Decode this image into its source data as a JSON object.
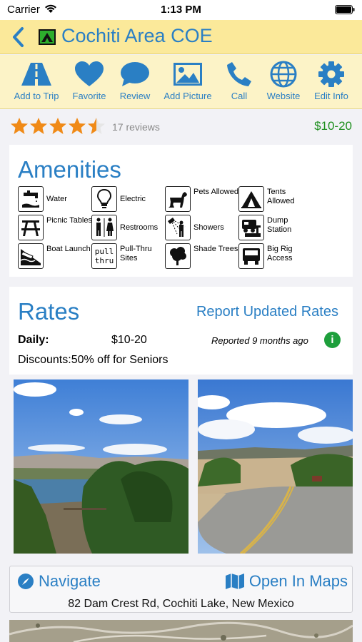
{
  "status_bar": {
    "carrier": "Carrier",
    "time": "1:13 PM"
  },
  "header": {
    "title": "Cochiti Area COE",
    "icon": "tent-icon"
  },
  "toolbar": [
    {
      "label": "Add to Trip",
      "icon": "road-icon"
    },
    {
      "label": "Favorite",
      "icon": "heart-icon"
    },
    {
      "label": "Review",
      "icon": "speech-bubble-icon"
    },
    {
      "label": "Add Picture",
      "icon": "image-icon"
    },
    {
      "label": "Call",
      "icon": "phone-icon"
    },
    {
      "label": "Website",
      "icon": "globe-icon"
    },
    {
      "label": "Edit Info",
      "icon": "gear-icon"
    }
  ],
  "rating": {
    "stars": 4.5,
    "max": 5,
    "reviews": "17 reviews",
    "price": "$10-20"
  },
  "amenities": {
    "title": "Amenities",
    "items": [
      {
        "label": "Water",
        "icon": "water-faucet-icon"
      },
      {
        "label": "Electric",
        "icon": "lightbulb-icon"
      },
      {
        "label": "Pets Allowed",
        "icon": "pets-icon"
      },
      {
        "label": "Tents Allowed",
        "icon": "tent-icon"
      },
      {
        "label": "Picnic Tables",
        "icon": "picnic-table-icon"
      },
      {
        "label": "Restrooms",
        "icon": "restroom-icon"
      },
      {
        "label": "Showers",
        "icon": "shower-icon"
      },
      {
        "label": "Dump Station",
        "icon": "dump-station-icon"
      },
      {
        "label": "Boat Launch",
        "icon": "boat-launch-icon"
      },
      {
        "label": "Pull-Thru Sites",
        "icon": "pull-thru-icon"
      },
      {
        "label": "Shade Trees",
        "icon": "tree-icon"
      },
      {
        "label": "Big Rig Access",
        "icon": "big-rig-icon"
      }
    ]
  },
  "rates": {
    "title": "Rates",
    "report_link": "Report Updated Rates",
    "daily_label": "Daily:",
    "daily_value": "$10-20",
    "reported": "Reported 9 months ago",
    "discounts": "Discounts:50% off for Seniors"
  },
  "pull_thru_text": {
    "line1": "pull",
    "line2": "thru"
  },
  "directions": {
    "navigate": "Navigate",
    "open_maps": "Open In Maps",
    "address": "82 Dam Crest Rd, Cochiti Lake, New Mexico"
  },
  "colors": {
    "accent": "#2a7fc4",
    "header_bg": "#fbe99a",
    "toolbar_bg": "#fcf3c7",
    "star": "#f08a17",
    "price": "#1e8f1e",
    "info": "#1e9f3c"
  }
}
